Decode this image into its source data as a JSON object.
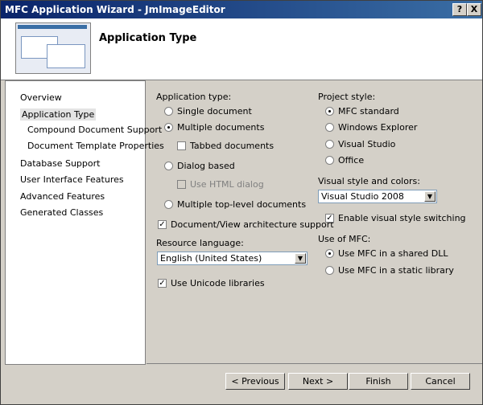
{
  "window": {
    "title": "MFC Application Wizard - JmImageEditor",
    "help_label": "?",
    "close_label": "X"
  },
  "header": {
    "title": "Application Type"
  },
  "sidebar": {
    "items": [
      {
        "label": "Overview"
      },
      {
        "label": "Application Type"
      },
      {
        "label": "Compound Document Support"
      },
      {
        "label": "Document Template Properties"
      },
      {
        "label": "Database Support"
      },
      {
        "label": "User Interface Features"
      },
      {
        "label": "Advanced Features"
      },
      {
        "label": "Generated Classes"
      }
    ]
  },
  "app_type": {
    "label": "Application type:",
    "single": "Single document",
    "multiple": "Multiple documents",
    "tabbed": "Tabbed documents",
    "dialog": "Dialog based",
    "html_dialog": "Use HTML dialog",
    "toplevel": "Multiple top-level documents",
    "docview": "Document/View architecture support",
    "resource_label": "Resource language:",
    "resource_value": "English (United States)",
    "unicode": "Use Unicode libraries"
  },
  "project_style": {
    "label": "Project style:",
    "mfc_standard": "MFC standard",
    "explorer": "Windows Explorer",
    "visual_studio": "Visual Studio",
    "office": "Office",
    "visual_style_label": "Visual style and colors:",
    "visual_style_value": "Visual Studio 2008",
    "enable_switching": "Enable visual style switching",
    "use_mfc_label": "Use of MFC:",
    "shared_dll": "Use MFC in a shared DLL",
    "static_lib": "Use MFC in a static library"
  },
  "buttons": {
    "previous": "< Previous",
    "next": "Next >",
    "finish": "Finish",
    "cancel": "Cancel"
  },
  "icons": {
    "check": "✓",
    "arrow": "▼"
  }
}
